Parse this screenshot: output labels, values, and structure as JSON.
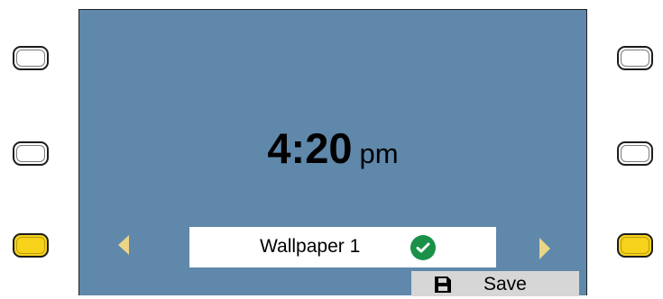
{
  "clock": {
    "time": "4:20",
    "meridiem": "pm"
  },
  "wallpaper_selector": {
    "label": "Wallpaper 1",
    "status_icon": "check-circle-icon",
    "status_color": "#1a9148"
  },
  "save_button": {
    "label": "Save",
    "icon": "floppy-disk-icon"
  },
  "side_buttons": {
    "left": [
      "inactive",
      "inactive",
      "active"
    ],
    "right": [
      "inactive",
      "inactive",
      "active"
    ],
    "active_color": "#f7d21a"
  },
  "colors": {
    "screen_background": "#5f88ab",
    "nav_arrow": "#ead486"
  }
}
